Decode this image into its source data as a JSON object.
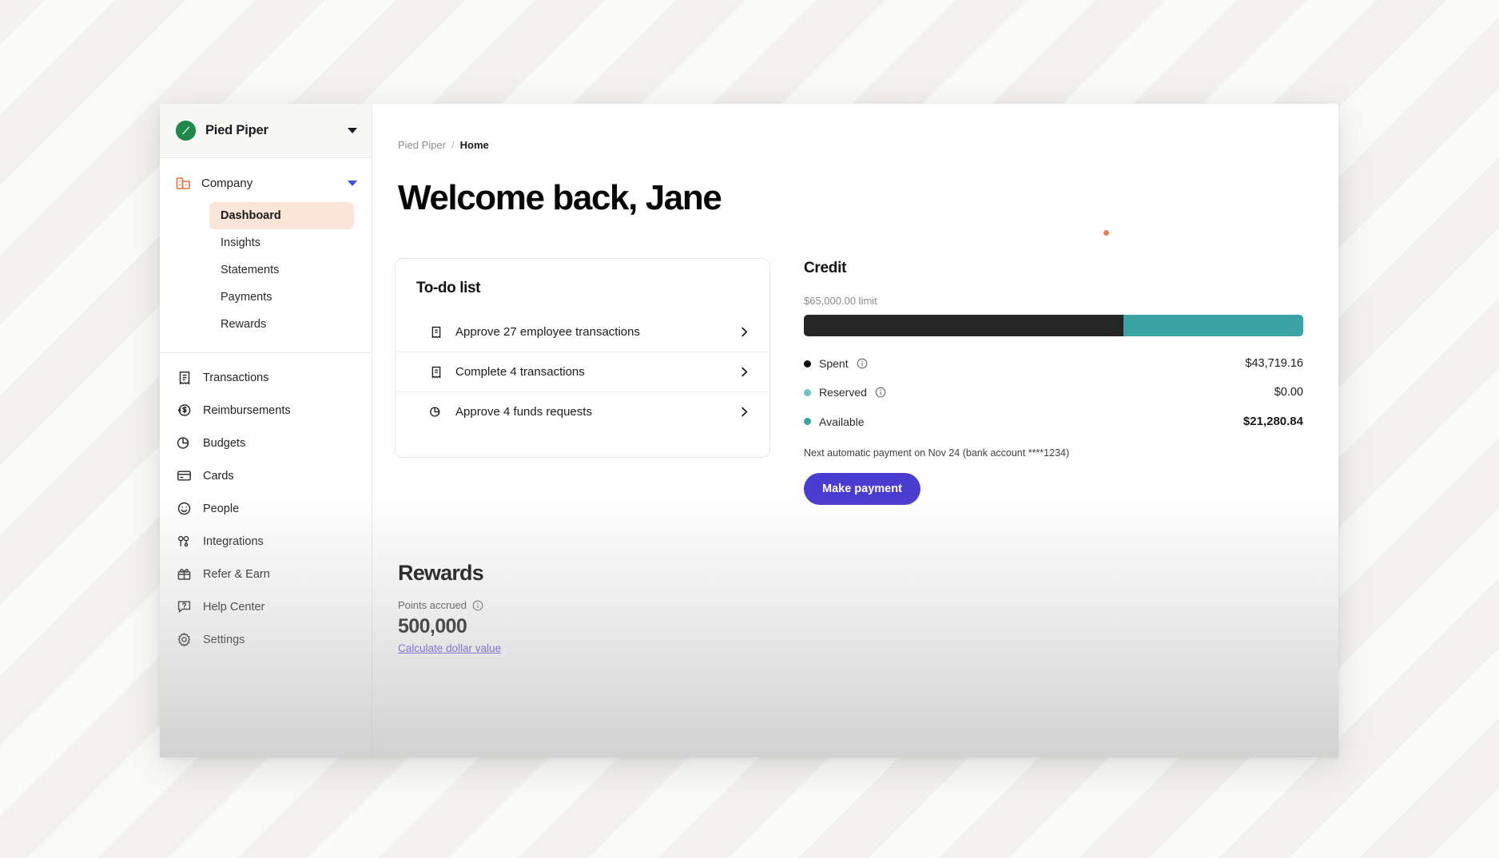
{
  "sidebar": {
    "org": {
      "name": "Pied Piper",
      "logo_icon": "pied-piper-logo",
      "caret_icon": "chevron-down-icon"
    },
    "company": {
      "label": "Company",
      "icon": "company-blocks-icon",
      "caret_icon": "chevron-down-icon"
    },
    "sub_items": [
      {
        "label": "Dashboard",
        "active": true
      },
      {
        "label": "Insights",
        "active": false
      },
      {
        "label": "Statements",
        "active": false
      },
      {
        "label": "Payments",
        "active": false
      },
      {
        "label": "Rewards",
        "active": false
      }
    ],
    "nav_items": [
      {
        "label": "Transactions",
        "icon": "receipt-icon"
      },
      {
        "label": "Reimbursements",
        "icon": "money-back-icon"
      },
      {
        "label": "Budgets",
        "icon": "pie-chart-icon"
      },
      {
        "label": "Cards",
        "icon": "credit-card-icon"
      },
      {
        "label": "People",
        "icon": "smiley-face-icon"
      },
      {
        "label": "Integrations",
        "icon": "puzzle-plug-icon"
      },
      {
        "label": "Refer & Earn",
        "icon": "gift-icon"
      },
      {
        "label": "Help Center",
        "icon": "question-bubble-icon"
      },
      {
        "label": "Settings",
        "icon": "gear-icon"
      }
    ]
  },
  "breadcrumb": {
    "org": "Pied Piper",
    "separator": "/",
    "current": "Home"
  },
  "page_title": "Welcome back, Jane",
  "todo": {
    "title": "To-do list",
    "items": [
      {
        "label": "Approve 27 employee transactions",
        "icon": "receipt-icon",
        "chevron": "chevron-right-icon"
      },
      {
        "label": "Complete 4 transactions",
        "icon": "receipt-icon",
        "chevron": "chevron-right-icon"
      },
      {
        "label": "Approve 4 funds requests",
        "icon": "pie-chart-icon",
        "chevron": "chevron-right-icon"
      }
    ]
  },
  "credit": {
    "title": "Credit",
    "limit_text": "$65,000.00 limit",
    "bar": {
      "spent_pct": 64,
      "available_pct": 36
    },
    "legend": [
      {
        "label": "Spent",
        "value": "$43,719.16",
        "color": "#111111",
        "has_info": true,
        "bold": false
      },
      {
        "label": "Reserved",
        "value": "$0.00",
        "color": "#6ec4c0",
        "has_info": true,
        "bold": false
      },
      {
        "label": "Available",
        "value": "$21,280.84",
        "color": "#3ba3a3",
        "has_info": false,
        "bold": true
      }
    ],
    "next_payment": "Next automatic payment on Nov 24 (bank account ****1234)",
    "make_payment_label": "Make payment"
  },
  "rewards": {
    "title": "Rewards",
    "points_label": "Points accrued",
    "points_value": "500,000",
    "calculate_link": "Calculate dollar value"
  },
  "colors": {
    "accent_purple": "#4b3cd0",
    "teal": "#3ba3a3",
    "dark": "#262626",
    "active_pill": "#fbe4d8",
    "brand_green": "#1f8a4c",
    "brand_orange": "#e2703a"
  }
}
